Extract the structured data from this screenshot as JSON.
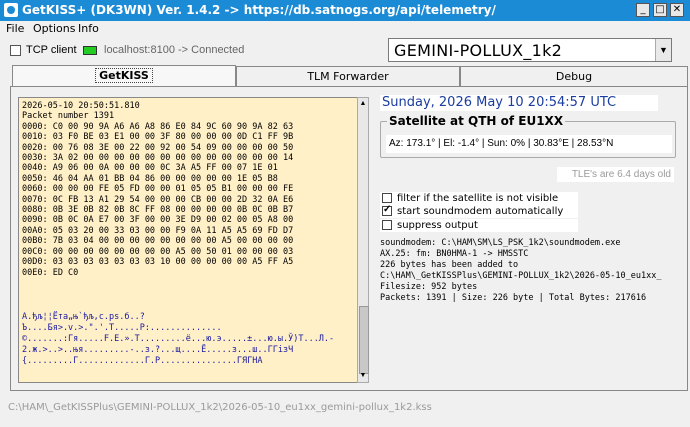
{
  "window": {
    "title": "GetKISS+ (DK3WN) Ver. 1.4.2 -> https://db.satnogs.org/api/telemetry/",
    "minimize_glyph": "_",
    "maximize_glyph": "□",
    "close_glyph": "✕"
  },
  "menu": {
    "items": [
      "File",
      "Options",
      "Info"
    ]
  },
  "connection": {
    "tcp_client_label": "TCP client",
    "tcp_client_checked": false,
    "status_text": "localhost:8100 -> Connected",
    "led_color": "#22cc22"
  },
  "satellite_select": {
    "value": "GEMINI-POLLUX_1k2",
    "arrow_glyph": "▼"
  },
  "tabs": [
    {
      "label": "GetKISS",
      "active": true
    },
    {
      "label": "TLM Forwarder",
      "active": false
    },
    {
      "label": "Debug",
      "active": false
    }
  ],
  "telemetry": {
    "hex_lines": [
      "2026-05-10 20:50:51.810",
      "Packet number 1391",
      "0000: C0 00 90 9A A6 A6 A8 86 E0 84 9C 60 90 9A 82 63",
      "0010: 03 F0 BE 03 E1 00 00 3F 80 00 00 00 0D C1 FF 9B",
      "0020: 00 76 08 3E 00 22 00 92 00 54 09 00 00 00 00 50",
      "0030: 3A 02 00 00 00 00 00 00 00 00 00 00 00 00 00 14",
      "0040: A9 06 00 0A 00 00 00 0C 3A A5 FF 00 07 1E 01",
      "0050: 46 04 AA 01 BB 04 86 00 00 00 00 00 1E 05 B8",
      "0060: 00 00 00 FE 05 FD 00 00 01 05 05 B1 00 00 00 FE",
      "0070: 0C FB 13 A1 29 54 00 00 00 CB 00 00 2D 32 0A E6",
      "0080: 0B 3E 0B 82 0B 8C FF 08 00 00 00 00 0B 0C 0B B7",
      "0090: 0B 0C 0A E7 00 3F 00 00 3E D9 00 02 00 05 A8 00",
      "00A0: 05 03 20 00 33 03 00 00 F9 0A 11 A5 A5 69 FD D7",
      "00B0: 7B 03 04 00 00 00 00 00 00 00 00 A5 00 00 00 00",
      "00C0: 00 00 00 00 00 00 00 00 A5 00 50 01 00 00 00 03",
      "00D0: 03 03 03 03 03 03 03 10 00 00 00 00 00 A5 FF A5",
      "00E0: ED C0"
    ],
    "decoded_lines": [
      "A.ђљ¦¦Ёта„њ`ђљ‚c.рѕ.б..?",
      "Ъ....Бя>.v.>.\".'.T.....P:..............",
      "©.......:Гя.....F.E.».Т.........ё...ю.э.....±...ю.ы.Ў)T...Л.-",
      "2.ж.>..>..њя.........-..з.?...щ....Ё.....з...ш..ГГізЧ",
      "{.........Г.............Г.Р...............ГЯГНА"
    ]
  },
  "datetime": "Sunday, 2026 May 10  20:54:57 UTC",
  "sat_qth": {
    "title": "Satellite at QTH of EU1XX",
    "info": "Az: 173.1° | El: -1.4° | Sun: 0% | 30.83°E | 28.53°N"
  },
  "tle_status": "TLE's are 6.4 days old",
  "options": [
    {
      "label": "filter if the satellite is not visible",
      "checked": false
    },
    {
      "label": "start soundmodem automatically",
      "checked": true
    },
    {
      "label": "suppress output",
      "checked": false
    }
  ],
  "log_lines": [
    "soundmodem: C:\\HAM\\SM\\LS_PSK_1k2\\soundmodem.exe",
    "AX.25: fm: BN0HMA-1 -> HMSSTC",
    "226 bytes has been added to",
    "C:\\HAM\\_GetKISSPlus\\GEMINI-POLLUX_1k2\\2026-05-10_eu1xx_",
    "Filesize: 952 bytes",
    "Packets: 1391 | Size: 226 byte | Total Bytes: 217616"
  ],
  "status_bar": "C:\\HAM\\_GetKISSPlus\\GEMINI-POLLUX_1k2\\2026-05-10_eu1xx_gemini-pollux_1k2.kss"
}
